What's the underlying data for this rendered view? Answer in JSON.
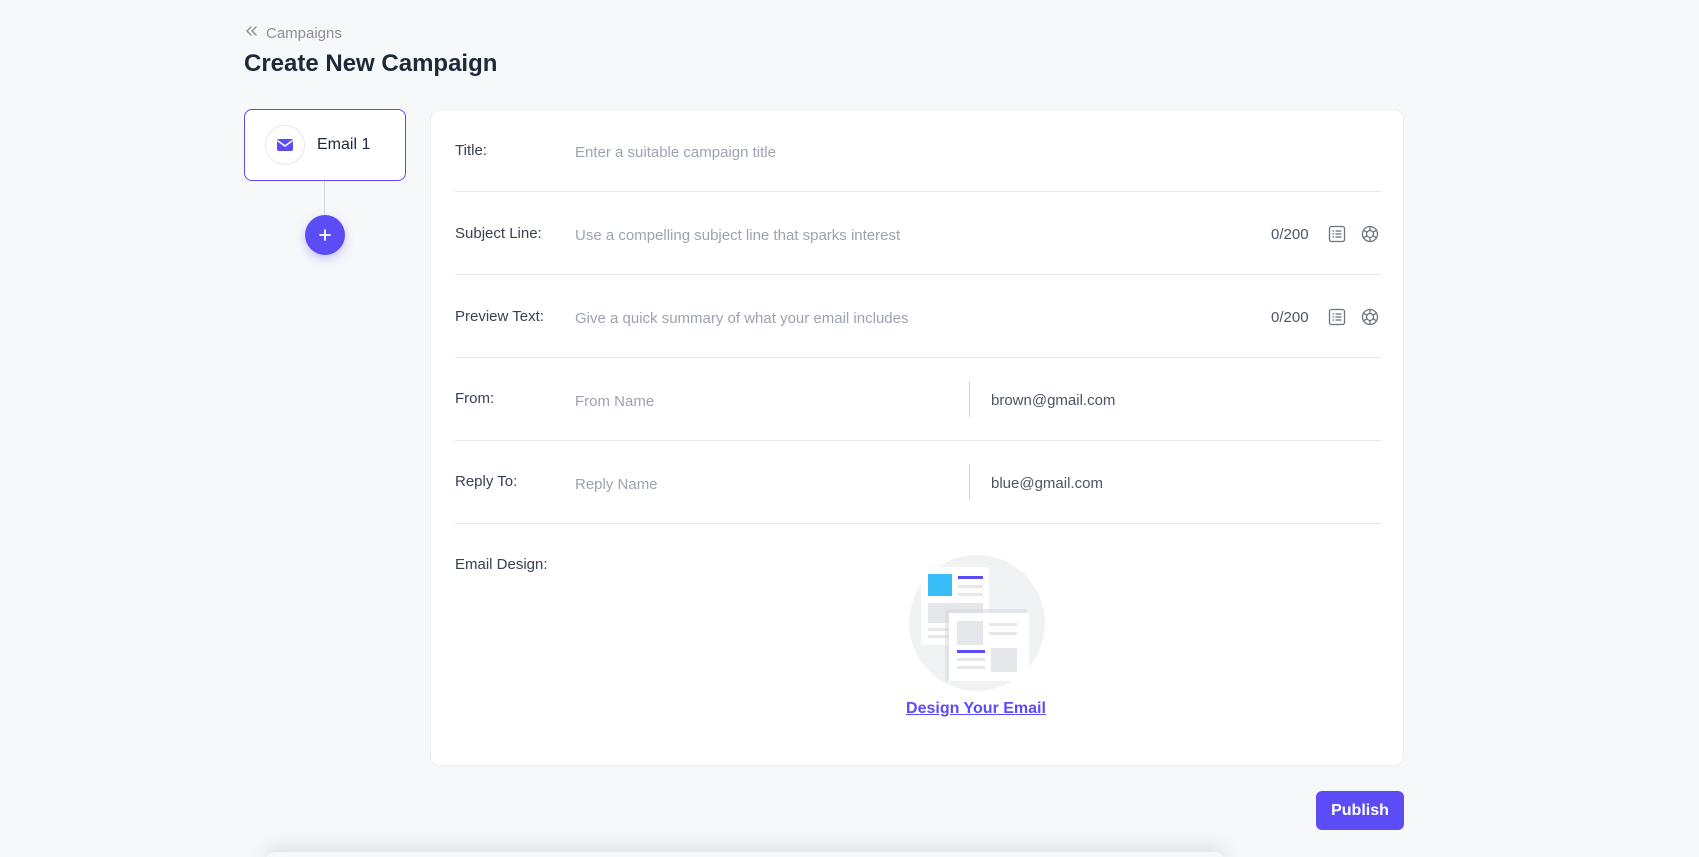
{
  "breadcrumb": {
    "label": "Campaigns"
  },
  "page": {
    "title": "Create New Campaign"
  },
  "steps": [
    {
      "label": "Email 1"
    }
  ],
  "form": {
    "title": {
      "label": "Title:",
      "placeholder": "Enter a suitable campaign title"
    },
    "subject": {
      "label": "Subject Line:",
      "placeholder": "Use a compelling subject line that sparks interest",
      "counter": "0/200"
    },
    "preview": {
      "label": "Preview Text:",
      "placeholder": "Give a quick summary of what your email includes",
      "counter": "0/200"
    },
    "from": {
      "label": "From:",
      "name_placeholder": "From Name",
      "email": "brown@gmail.com"
    },
    "reply_to": {
      "label": "Reply To:",
      "name_placeholder": "Reply Name",
      "email": "blue@gmail.com"
    },
    "email_design": {
      "label": "Email Design:",
      "link": "Design Your Email"
    }
  },
  "actions": {
    "publish_label": "Publish"
  },
  "icons": {
    "breadcrumb": "double-chevron-left-icon",
    "step": "mail-icon",
    "add": "plus-icon",
    "template": "list-template-icon",
    "ai": "ai-assistant-icon"
  },
  "colors": {
    "accent": "#5b4cf5",
    "illustration_blue": "#38bdf8"
  }
}
